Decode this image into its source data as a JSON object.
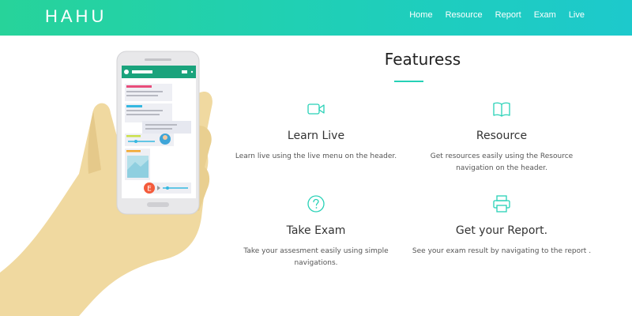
{
  "header": {
    "brand": "HAHU",
    "nav": [
      {
        "label": "Home"
      },
      {
        "label": "Resource"
      },
      {
        "label": "Report"
      },
      {
        "label": "Exam"
      },
      {
        "label": "Live"
      }
    ]
  },
  "features": {
    "title": "Featuress",
    "items": [
      {
        "icon": "video-camera-icon",
        "title": "Learn Live",
        "description": "Learn live using the live menu on the header."
      },
      {
        "icon": "open-book-icon",
        "title": "Resource",
        "description": "Get resources easily using the Resource navigation on the header."
      },
      {
        "icon": "question-circle-icon",
        "title": "Take Exam",
        "description": "Take your assesment easily using simple navigations."
      },
      {
        "icon": "printer-icon",
        "title": "Get your Report.",
        "description": "See your exam result by navigating to the report ."
      }
    ]
  },
  "illustration": {
    "chat_avatar_letter": "E"
  },
  "colors": {
    "accent": "#26d1b6",
    "header_start": "#27d39a",
    "header_end": "#1dc9cc",
    "skin": "#f0d9a0",
    "phone_bar": "#1aa37c"
  }
}
